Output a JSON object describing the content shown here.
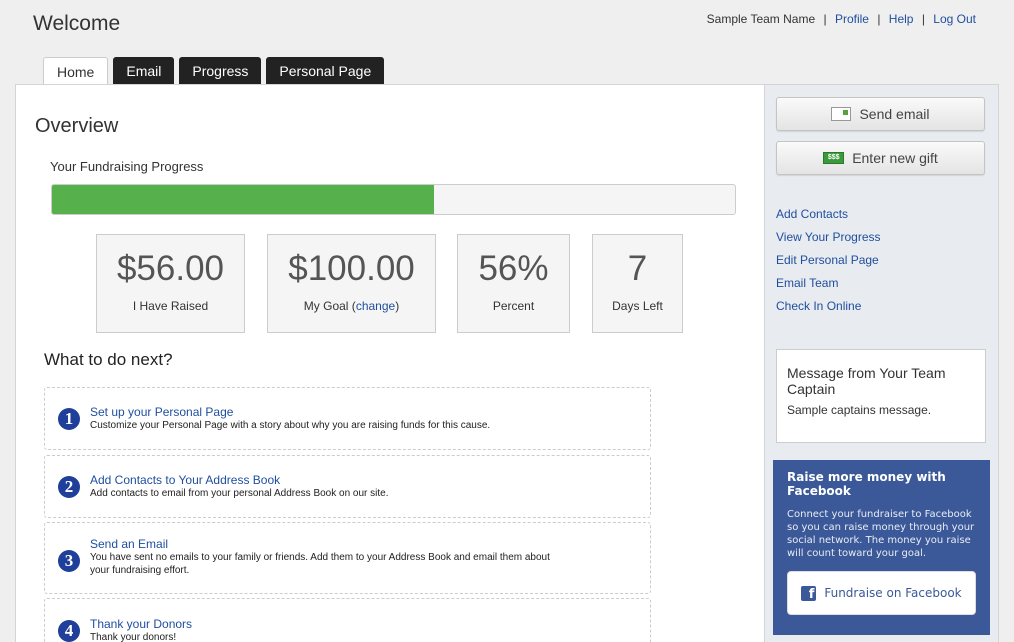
{
  "header": {
    "title": "Welcome",
    "team_name": "Sample Team Name",
    "links": [
      "Profile",
      "Help",
      "Log Out"
    ]
  },
  "tabs": [
    {
      "label": "Home",
      "active": true
    },
    {
      "label": "Email",
      "active": false
    },
    {
      "label": "Progress",
      "active": false
    },
    {
      "label": "Personal Page",
      "active": false
    }
  ],
  "overview": {
    "title": "Overview",
    "progress_label": "Your Fundraising Progress",
    "progress_fraction": 0.56,
    "progress_color": "#56b04b",
    "stats": [
      {
        "value": "$56.00",
        "label": "I Have Raised"
      },
      {
        "value": "$100.00",
        "label_prefix": "My Goal (",
        "link": "change",
        "label_suffix": ")"
      },
      {
        "value": "56%",
        "label": "Percent"
      },
      {
        "value": "7",
        "label": "Days Left"
      }
    ]
  },
  "next_steps": {
    "title": "What to do next?",
    "items": [
      {
        "num": "1",
        "title": "Set up your Personal Page",
        "desc": "Customize your Personal Page with a story about why you are raising funds for this cause."
      },
      {
        "num": "2",
        "title": "Add Contacts to Your Address Book",
        "desc": "Add contacts to email from your personal Address Book on our site."
      },
      {
        "num": "3",
        "title": "Send an Email",
        "desc": "You have sent no emails to your family or friends. Add them to your Address Book and email them about your fundraising effort."
      },
      {
        "num": "4",
        "title": "Thank your Donors",
        "desc": "Thank your donors!"
      }
    ]
  },
  "sidebar": {
    "send_email": "Send email",
    "enter_gift": "Enter new gift",
    "money_icon_text": "$$$",
    "links": [
      "Add Contacts",
      "View Your Progress",
      "Edit Personal Page",
      "Email Team",
      "Check In Online"
    ],
    "message": {
      "title": "Message from Your Team Captain",
      "body": "Sample captains message."
    },
    "facebook": {
      "title": "Raise more money with Facebook",
      "desc": "Connect your fundraiser to Facebook so you can raise money through your social network. The money you raise will count toward your goal.",
      "button": "Fundraise on Facebook",
      "color": "#3b5998"
    }
  }
}
